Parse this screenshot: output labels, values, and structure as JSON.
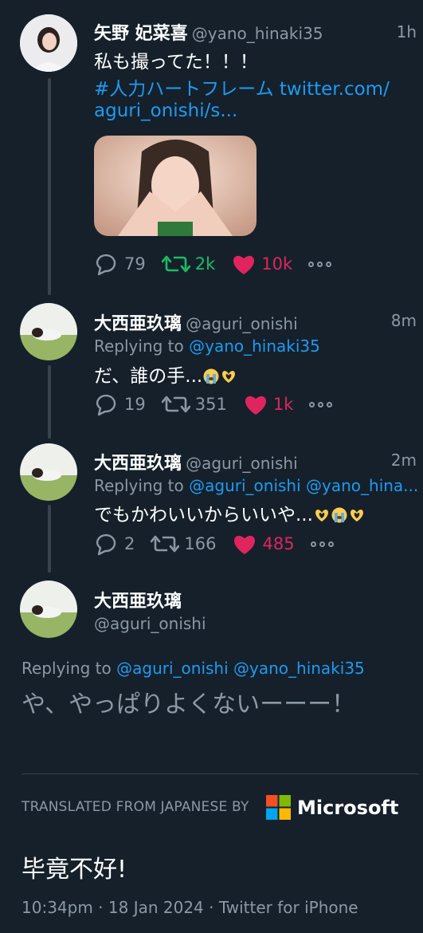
{
  "tweets": [
    {
      "name": "矢野 妃菜喜",
      "handle": "@yano_hinaki35",
      "time": "1h",
      "text_line1": "私も撮ってた！！！",
      "text_line2": "#人力ハートフレーム twitter.com/",
      "text_line3": "aguri_onishi/s...",
      "hashtag": "#人力ハートフレーム",
      "link_part": "twitter.com/",
      "reply_count": "79",
      "retweet_count": "2k",
      "like_count": "10k"
    },
    {
      "name": "大西亜玖璃",
      "handle": "@aguri_onishi",
      "time": "8m",
      "replying_label": "Replying to",
      "replying_to": "@yano_hinaki35",
      "text": "だ、誰の手...",
      "emojis": [
        "loudly-crying-face",
        "heart-hands"
      ],
      "reply_count": "19",
      "retweet_count": "351",
      "like_count": "1k"
    },
    {
      "name": "大西亜玖璃",
      "handle": "@aguri_onishi",
      "time": "2m",
      "replying_label": "Replying to",
      "replying_to": "@aguri_onishi @yano_hina...",
      "text": "でもかわいいからいいや...",
      "emojis": [
        "heart-hands",
        "loudly-crying-face",
        "heart-hands"
      ],
      "reply_count": "2",
      "retweet_count": "166",
      "like_count": "485"
    }
  ],
  "main_tweet": {
    "name": "大西亜玖璃",
    "handle": "@aguri_onishi",
    "replying_label": "Replying to",
    "replying_to": "@aguri_onishi @yano_hinaki35",
    "text": "や、やっぱりよくないーーー！",
    "translated_label": "TRANSLATED FROM JAPANESE BY",
    "translator": "Microsoft",
    "translation": "毕竟不好!",
    "meta": "10:34pm · 18 Jan 2024 · Twitter for iPhone"
  },
  "colors": {
    "background": "#15202b",
    "link": "#1d9bf0",
    "muted": "#8b98a5",
    "retweet": "#17bf63",
    "like": "#e0245e"
  }
}
